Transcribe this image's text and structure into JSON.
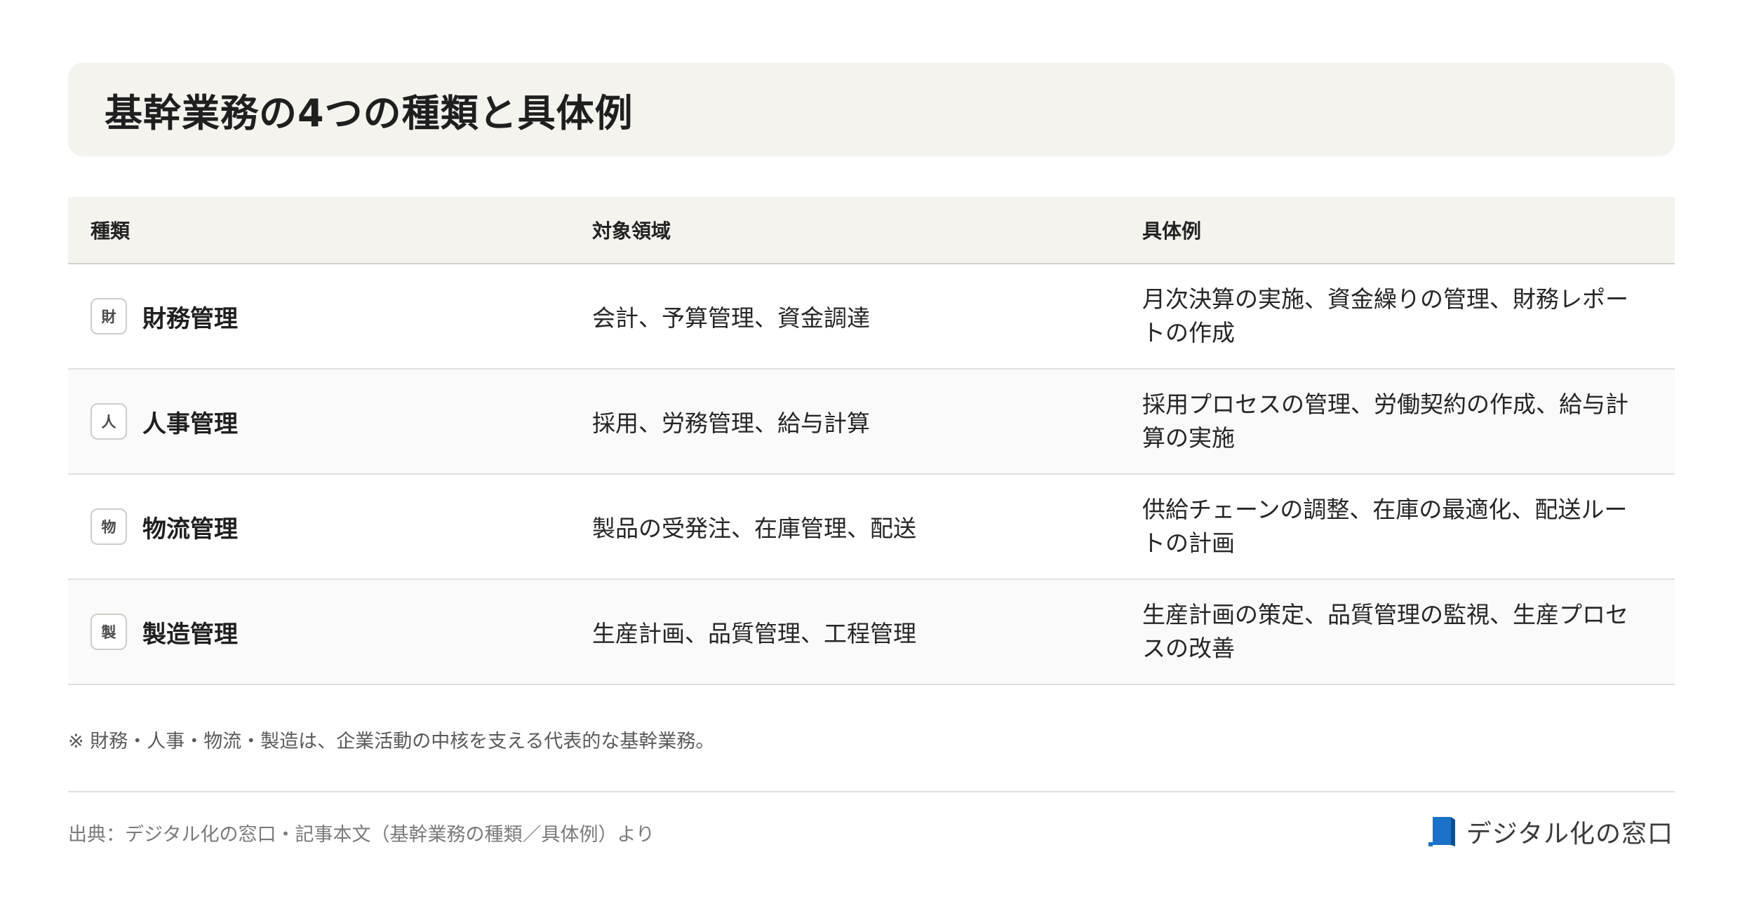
{
  "title": "基幹業務の4つの種類と具体例",
  "table": {
    "headers": [
      "種類",
      "対象領域",
      "具体例"
    ],
    "rows": [
      {
        "badge": "財",
        "type": "財務管理",
        "domain": "会計、予算管理、資金調達",
        "examples": "月次決算の実施、資金繰りの管理、財務レポートの作成"
      },
      {
        "badge": "人",
        "type": "人事管理",
        "domain": "採用、労務管理、給与計算",
        "examples": "採用プロセスの管理、労働契約の作成、給与計算の実施"
      },
      {
        "badge": "物",
        "type": "物流管理",
        "domain": "製品の受発注、在庫管理、配送",
        "examples": "供給チェーンの調整、在庫の最適化、配送ルートの計画"
      },
      {
        "badge": "製",
        "type": "製造管理",
        "domain": "生産計画、品質管理、工程管理",
        "examples": "生産計画の策定、品質管理の監視、生産プロセスの改善"
      }
    ]
  },
  "footnote": "※ 財務・人事・物流・製造は、企業活動の中核を支える代表的な基幹業務。",
  "source": "出典：デジタル化の窓口・記事本文（基幹業務の種類／具体例）より",
  "logo": {
    "text": "デジタル化の窓口",
    "icon": "window-logo-icon",
    "color": "#1a73c8"
  }
}
